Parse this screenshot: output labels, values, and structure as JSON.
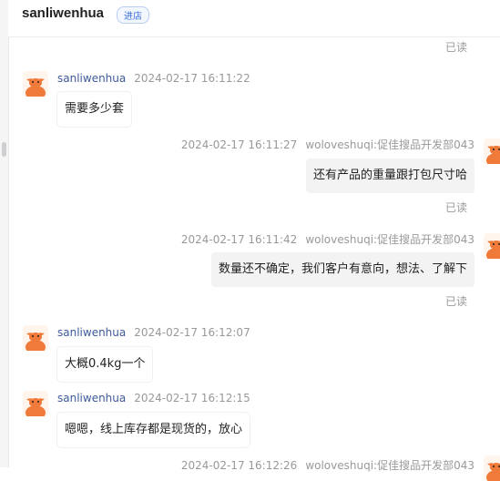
{
  "header": {
    "shop_name": "sanliwenhua",
    "enter_badge": "进店"
  },
  "read_label": "已读",
  "messages": [
    {
      "sender": "sanliwenhua",
      "time": "2024-02-17 16:11:22",
      "text": "需要多少套"
    },
    {
      "sender": "woloveshuqi:促佳搜品开发部043",
      "time": "2024-02-17 16:11:27",
      "text": "还有产品的重量跟打包尺寸哈"
    },
    {
      "sender": "woloveshuqi:促佳搜品开发部043",
      "time": "2024-02-17 16:11:42",
      "text": "数量还不确定，我们客户有意向，想法、了解下"
    },
    {
      "sender": "sanliwenhua",
      "time": "2024-02-17 16:12:07",
      "text": "大概0.4kg一个"
    },
    {
      "sender": "sanliwenhua",
      "time": "2024-02-17 16:12:15",
      "text": "嗯嗯，线上库存都是现货的，放心"
    },
    {
      "sender": "woloveshuqi:促佳搜品开发部043",
      "time": "2024-02-17 16:12:26",
      "text": ""
    }
  ],
  "colors": {
    "accent": "#3a6fd8",
    "sender_name": "#3e5a99",
    "outgoing_bubble": "#f3f3f4",
    "avatar_orange": "#f07a3a"
  }
}
